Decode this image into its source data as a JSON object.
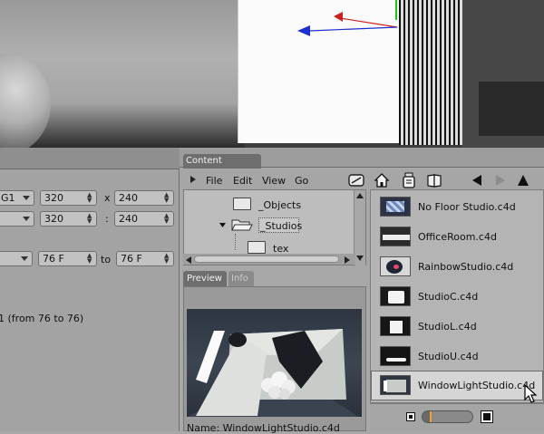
{
  "left_panel": {
    "resolution_preset": "G1",
    "width": "320",
    "height": "240",
    "x_separator": "x",
    "width2": "320",
    "height2": "240",
    "ratio_separator": ":",
    "frame_from": "76 F",
    "frame_to": "76 F",
    "to_label": "to",
    "frames_summary": "1 (from 76 to 76)"
  },
  "content_browser": {
    "tab_label": "Content Browser",
    "menus": [
      "File",
      "Edit",
      "View",
      "Go"
    ],
    "tree": [
      {
        "label": "_Objects"
      },
      {
        "label": "_Studios"
      },
      {
        "label": "tex"
      }
    ],
    "preview_tab": "Preview",
    "info_tab": "Info",
    "preview_name": "Name: WindowLightStudio.c4d",
    "files": [
      {
        "label": "No Floor Studio.c4d"
      },
      {
        "label": "OfficeRoom.c4d"
      },
      {
        "label": "RainbowStudio.c4d"
      },
      {
        "label": "StudioC.c4d"
      },
      {
        "label": "StudioL.c4d"
      },
      {
        "label": "StudioU.c4d"
      },
      {
        "label": "WindowLightStudio.c4d"
      }
    ],
    "selected_file": "WindowLightStudio.c4d"
  },
  "colors": {
    "panel_bg": "#a3a3a3",
    "tab_bg": "#6e6e6e",
    "selection_bg": "#d5d5d5",
    "axis_red": "#cc1f1f",
    "axis_blue": "#1c2fd0",
    "axis_green": "#1bc41b"
  }
}
